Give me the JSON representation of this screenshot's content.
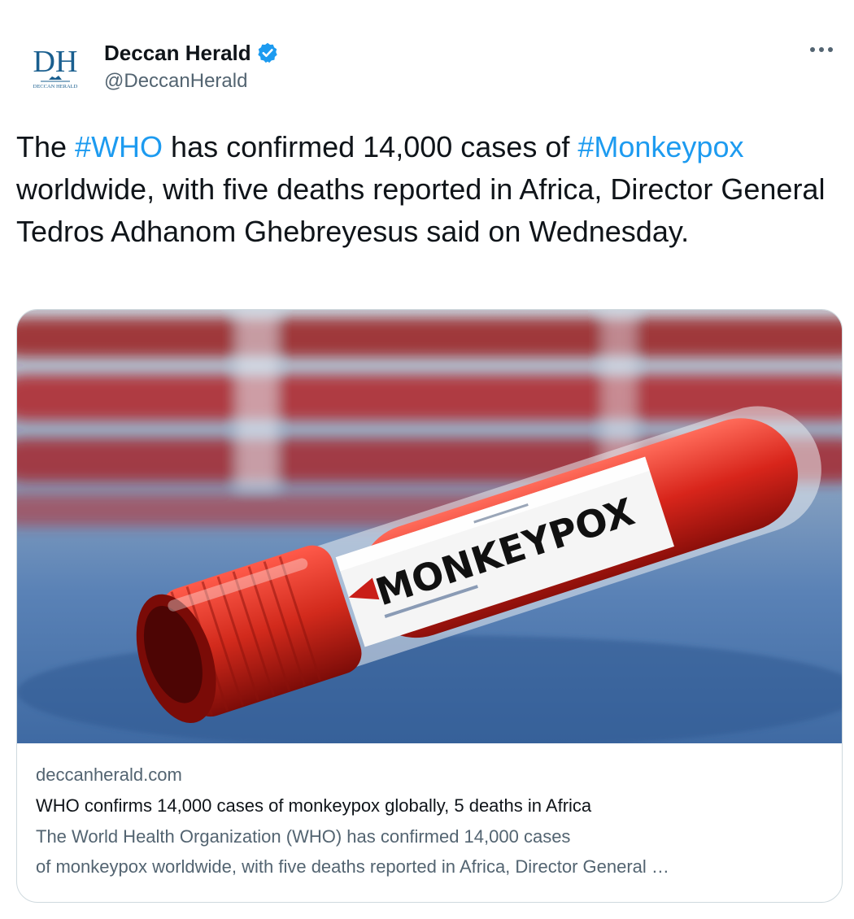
{
  "account": {
    "logo_text": "DH",
    "logo_subtext": "DECCAN HERALD",
    "display_name": "Deccan Herald",
    "handle": "@DeccanHerald",
    "verified": true,
    "icons": {
      "verified": "verified-badge-icon",
      "more": "more-options-icon"
    }
  },
  "tweet": {
    "segments": [
      {
        "text": "The "
      },
      {
        "text": "#WHO",
        "hashtag": true
      },
      {
        "text": " has confirmed 14,000 cases of "
      },
      {
        "text": "#Monkeypox",
        "hashtag": true
      },
      {
        "text": " worldwide, with five deaths reported in Africa, Director General Tedros Adhanom Ghebreyesus said on Wednesday."
      }
    ]
  },
  "link_card": {
    "image_label": "MONKEYPOX",
    "domain": "deccanherald.com",
    "title": "WHO confirms 14,000 cases of monkeypox globally, 5 deaths in Africa",
    "description_line1": "The World Health Organization (WHO) has confirmed 14,000 cases",
    "description_line2": "of monkeypox worldwide, with five deaths reported in Africa, Director General …"
  },
  "colors": {
    "hashtag": "#1d9bf0",
    "verified": "#1d9bf0",
    "logo": "#1a5f8f",
    "secondary_text": "#536471",
    "border": "#cfd9de"
  }
}
